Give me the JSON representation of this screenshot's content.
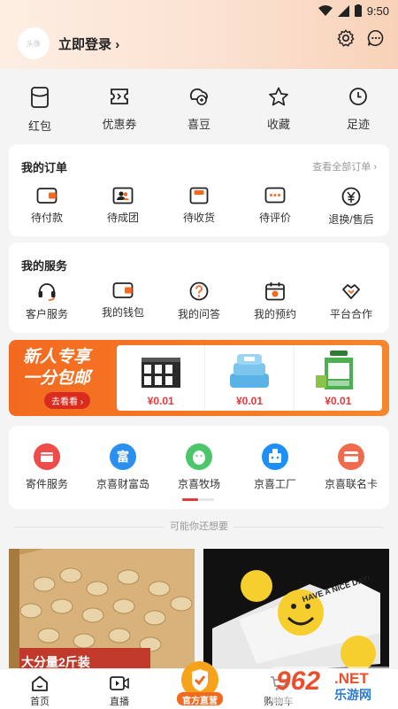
{
  "status": {
    "time": "9:50"
  },
  "header": {
    "avatar_text": "头像",
    "login_label": "立即登录",
    "chevron": "›"
  },
  "quick": [
    {
      "label": "红包",
      "icon": "red-packet-icon"
    },
    {
      "label": "优惠券",
      "icon": "coupon-icon"
    },
    {
      "label": "喜豆",
      "icon": "bean-icon"
    },
    {
      "label": "收藏",
      "icon": "star-icon"
    },
    {
      "label": "足迹",
      "icon": "clock-icon"
    }
  ],
  "orders": {
    "title": "我的订单",
    "view_all": "查看全部订单 ›",
    "items": [
      {
        "label": "待付款",
        "icon": "wallet-icon"
      },
      {
        "label": "待成团",
        "icon": "group-icon"
      },
      {
        "label": "待收货",
        "icon": "package-icon"
      },
      {
        "label": "待评价",
        "icon": "comment-icon"
      },
      {
        "label": "退换/售后",
        "icon": "refund-icon"
      }
    ]
  },
  "services": {
    "title": "我的服务",
    "items": [
      {
        "label": "客户服务",
        "icon": "headset-icon"
      },
      {
        "label": "我的钱包",
        "icon": "wallet-icon"
      },
      {
        "label": "我的问答",
        "icon": "question-icon"
      },
      {
        "label": "我的预约",
        "icon": "calendar-icon"
      },
      {
        "label": "平台合作",
        "icon": "handshake-icon"
      }
    ]
  },
  "banner": {
    "title1": "新人专享",
    "title2": "一分包邮",
    "button": "去看看 ›",
    "products": [
      {
        "price": "¥0.01"
      },
      {
        "price": "¥0.01"
      },
      {
        "price": "¥0.01"
      }
    ]
  },
  "more_services": [
    {
      "label": "寄件服务",
      "icon": "parcel-icon",
      "color": "#ee4b4b"
    },
    {
      "label": "京喜财富岛",
      "icon": "fortune-icon",
      "color": "#2b8ff0",
      "glyph": "富"
    },
    {
      "label": "京喜牧场",
      "icon": "chick-icon",
      "color": "#4cc56b"
    },
    {
      "label": "京喜工厂",
      "icon": "factory-icon",
      "color": "#1e8ff5"
    },
    {
      "label": "京喜联名卡",
      "icon": "card-icon",
      "color": "#f06b4b"
    }
  ],
  "guess_label": "可能你还想要",
  "products": [
    {
      "caption": "大分量2斤装"
    },
    {
      "caption": "HAVE A NICE DAY!"
    }
  ],
  "tabbar": [
    {
      "label": "首页",
      "icon": "home-icon"
    },
    {
      "label": "直播",
      "icon": "live-icon"
    },
    {
      "label": "官方直营",
      "icon": "official-store-icon"
    },
    {
      "label": "购物车",
      "icon": "cart-icon"
    }
  ],
  "watermark": {
    "text": "962",
    "sub": "乐游网",
    "suffix": ".NET"
  },
  "colors": {
    "accent": "#e4393c",
    "banner": "#f36a1f",
    "header": "#fbe0cf"
  }
}
